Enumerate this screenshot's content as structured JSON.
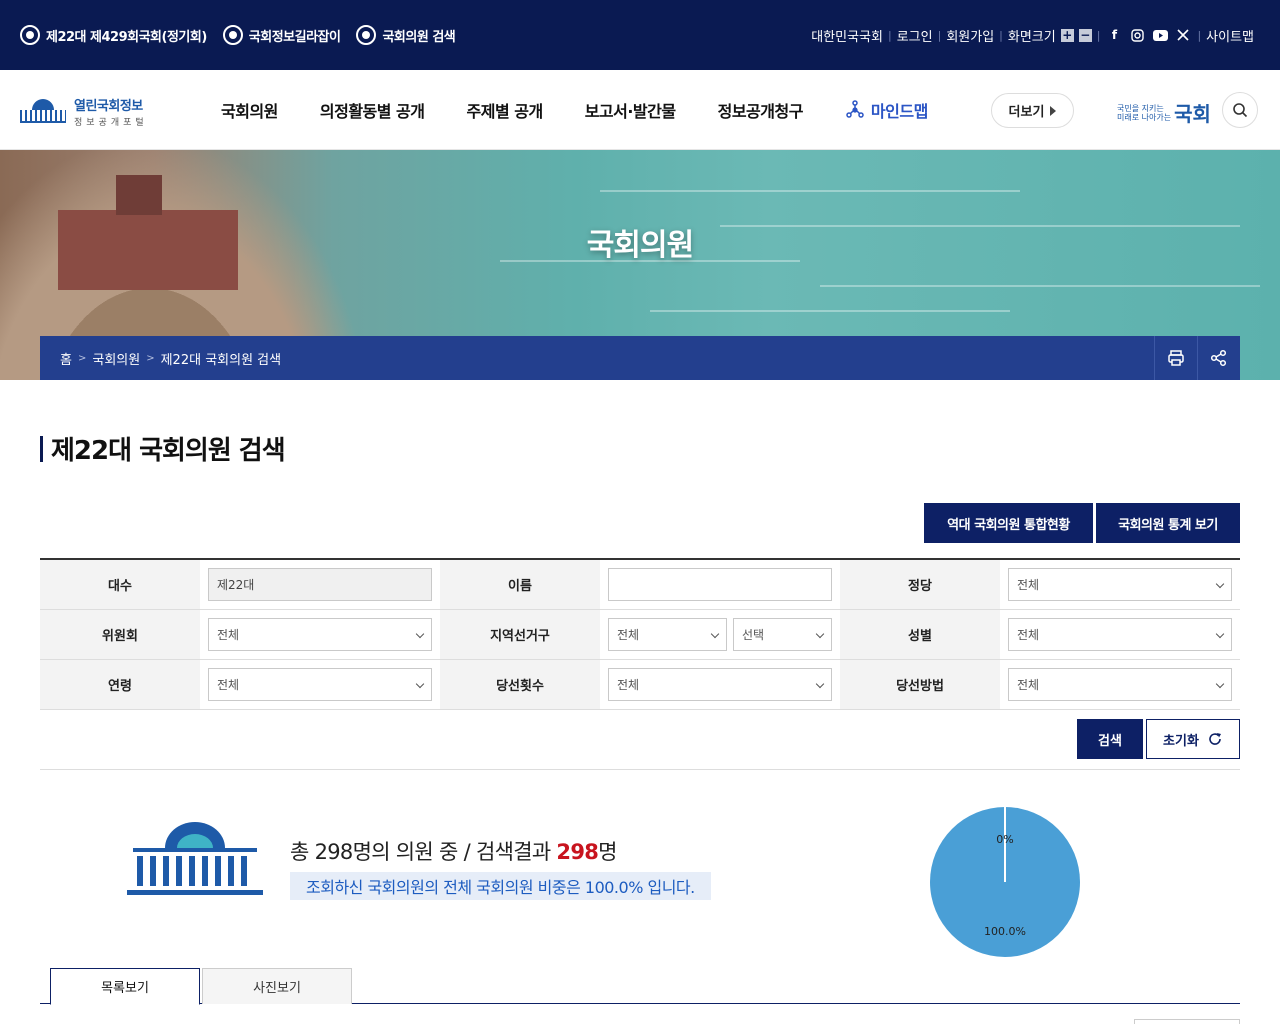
{
  "topbar": {
    "left_items": [
      "제22대 제429회국회(정기회)",
      "국회정보길라잡이",
      "국회의원 검색"
    ],
    "links": [
      "대한민국국회",
      "로그인",
      "회원가입",
      "화면크기"
    ],
    "zoom_plus": "+",
    "zoom_minus": "−",
    "sitemap": "사이트맵"
  },
  "header": {
    "logo_title": "열린국회정보",
    "logo_sub": "정보공개포털",
    "nav": [
      "국회의원",
      "의정활동별 공개",
      "주제별 공개",
      "보고서·발간물",
      "정보공개청구"
    ],
    "mindmap": "마인드맵",
    "more": "더보기",
    "nat_logo_small1": "국민을 지키는",
    "nat_logo_small2": "미래로 나아가는",
    "nat_logo_big": "국회"
  },
  "banner": {
    "title": "국회의원",
    "breadcrumb": [
      "홈",
      "국회의원",
      "제22대 국회의원 검색"
    ]
  },
  "page": {
    "title": "제22대 국회의원 검색",
    "btn_history": "역대 국회의원 통합현황",
    "btn_stats": "국회의원 통계 보기"
  },
  "search": {
    "labels": {
      "daesu": "대수",
      "name": "이름",
      "party": "정당",
      "committee": "위원회",
      "district": "지역선거구",
      "gender": "성별",
      "age": "연령",
      "elected_count": "당선횟수",
      "elect_method": "당선방법"
    },
    "values": {
      "daesu": "제22대",
      "name": "",
      "party": "전체",
      "committee": "전체",
      "district1": "전체",
      "district2": "선택",
      "gender": "전체",
      "age": "전체",
      "elected_count": "전체",
      "elect_method": "전체"
    },
    "btn_search": "검색",
    "btn_reset": "초기화"
  },
  "result": {
    "line1_prefix": "총 298명의 의원 중 / 검색결과 ",
    "count": "298",
    "line1_suffix": "명",
    "line2": "조회하신 국회의원의 전체 국회의원 비중은 100.0% 입니다.",
    "pie_label_other": "0%",
    "pie_label_main": "100.0%"
  },
  "chart_data": {
    "type": "pie",
    "categories": [
      "",
      ""
    ],
    "values": [
      100.0,
      0
    ],
    "labels": [
      "100.0%",
      "0%"
    ],
    "colors": [
      "#4a9fd6",
      "#ffffff"
    ]
  },
  "tabs": [
    "목록보기",
    "사진보기"
  ],
  "colors": {
    "navy": "#0a1a52",
    "button": "#0d2065",
    "accent_red": "#c8141e",
    "accent_blue": "#1d5cc0"
  }
}
